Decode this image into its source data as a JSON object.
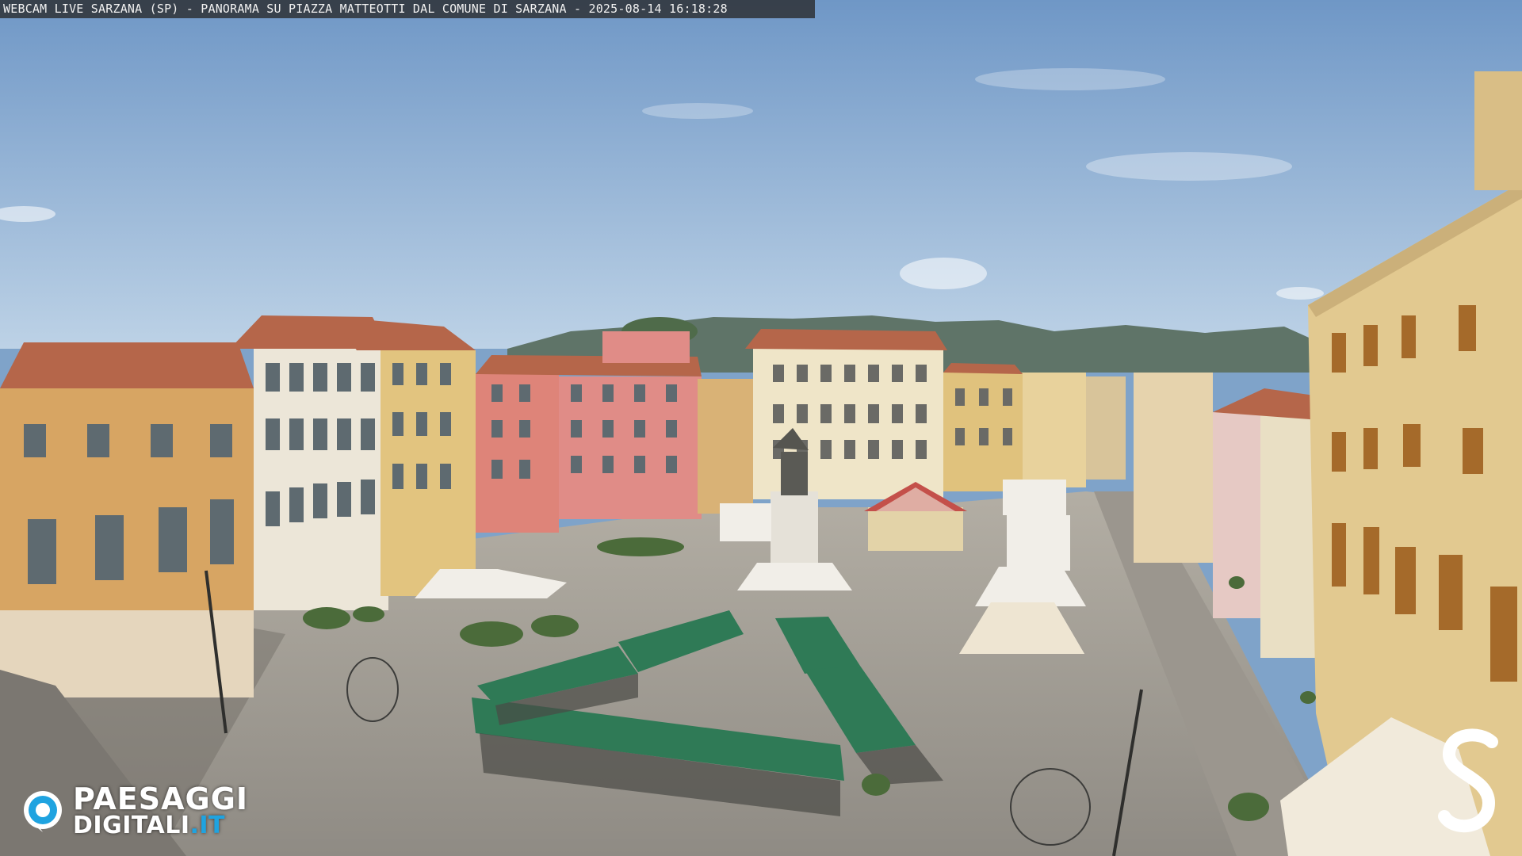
{
  "overlay": {
    "caption": "WEBCAM LIVE SARZANA (SP) - PANORAMA SU PIAZZA MATTEOTTI DAL COMUNE DI SARZANA - 2025-08-14  16:18:28"
  },
  "watermark": {
    "brand_line1": "PAESAGGI",
    "brand_line2": "DIGITALI",
    "brand_suffix": ".IT",
    "corner_mark": "S"
  },
  "colors": {
    "sky_top": "#6f97c6",
    "sky_bottom": "#b9cfe4",
    "mountains": "#5f7468",
    "pavement": "#a39f97",
    "stall_green": "#2f7a56",
    "roof_terracotta": "#b5664a",
    "ochre": "#d7a563",
    "pink": "#de8479",
    "cream": "#e9dcc0",
    "brand_blue": "#1fa3e0"
  }
}
